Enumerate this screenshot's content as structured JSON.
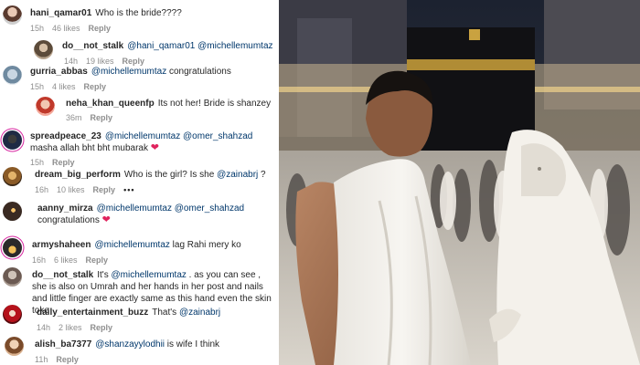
{
  "comments": [
    {
      "user": "hani_qamar01",
      "segments": [
        {
          "t": "Who is the bride????"
        }
      ],
      "time": "15h",
      "likes": "46 likes",
      "reply": "Reply"
    },
    {
      "user": "do__not_stalk",
      "segments": [
        {
          "t": "@hani_qamar01",
          "m": true
        },
        {
          "t": " "
        },
        {
          "t": "@michellemumtaz",
          "m": true
        }
      ],
      "time": "14h",
      "likes": "19 likes",
      "reply": "Reply"
    },
    {
      "user": "gurria_abbas",
      "segments": [
        {
          "t": "@michellemumtaz",
          "m": true
        },
        {
          "t": " congratulations"
        }
      ],
      "time": "15h",
      "likes": "4 likes",
      "reply": "Reply"
    },
    {
      "user": "neha_khan_queenfp",
      "segments": [
        {
          "t": "Its not her! Bride is shanzey"
        }
      ],
      "time": "36m",
      "likes": "",
      "reply": "Reply"
    },
    {
      "user": "spreadpeace_23",
      "segments": [
        {
          "t": "@michellemumtaz",
          "m": true
        },
        {
          "t": " "
        },
        {
          "t": "@omer_shahzad",
          "m": true
        },
        {
          "t": " masha allah bht bht mubarak "
        },
        {
          "t": "❤",
          "h": true
        }
      ],
      "time": "15h",
      "likes": "",
      "reply": "Reply"
    },
    {
      "user": "dream_big_perform",
      "segments": [
        {
          "t": "Who is the girl? Is she "
        },
        {
          "t": "@zainabrj",
          "m": true
        },
        {
          "t": " ?"
        }
      ],
      "time": "16h",
      "likes": "10 likes",
      "reply": "Reply",
      "more": "•••"
    },
    {
      "user": "aanny_mirza",
      "segments": [
        {
          "t": "@michellemumtaz",
          "m": true
        },
        {
          "t": " "
        },
        {
          "t": "@omer_shahzad",
          "m": true
        },
        {
          "t": " congratulations "
        },
        {
          "t": "❤",
          "h": true
        }
      ],
      "time": "16h",
      "likes": "",
      "reply": "Reply"
    },
    {
      "user": "armyshaheen",
      "segments": [
        {
          "t": "@michellemumtaz",
          "m": true
        },
        {
          "t": " lag Rahi mery ko"
        }
      ],
      "time": "16h",
      "likes": "6 likes",
      "reply": "Reply"
    },
    {
      "user": "do__not_stalk",
      "segments": [
        {
          "t": "It's "
        },
        {
          "t": "@michellemumtaz",
          "m": true
        },
        {
          "t": " . as you can see , she is also on Umrah and her hands in her post and nails and little finger are exactly same as this hand even the skin toke"
        }
      ],
      "time": "",
      "likes": "",
      "reply": ""
    },
    {
      "user": "daily_entertainment_buzz",
      "segments": [
        {
          "t": "That's "
        },
        {
          "t": "@zainabrj",
          "m": true
        }
      ],
      "time": "14h",
      "likes": "2 likes",
      "reply": "Reply"
    },
    {
      "user": "alish_ba7377",
      "segments": [
        {
          "t": "@shanzayylodhii",
          "m": true
        },
        {
          "t": " is wife I think"
        }
      ],
      "time": "11h",
      "likes": "",
      "reply": "Reply"
    }
  ],
  "colors": {
    "mention": "#00376b",
    "meta": "#8e8e8e",
    "heart": "#e0245e"
  }
}
